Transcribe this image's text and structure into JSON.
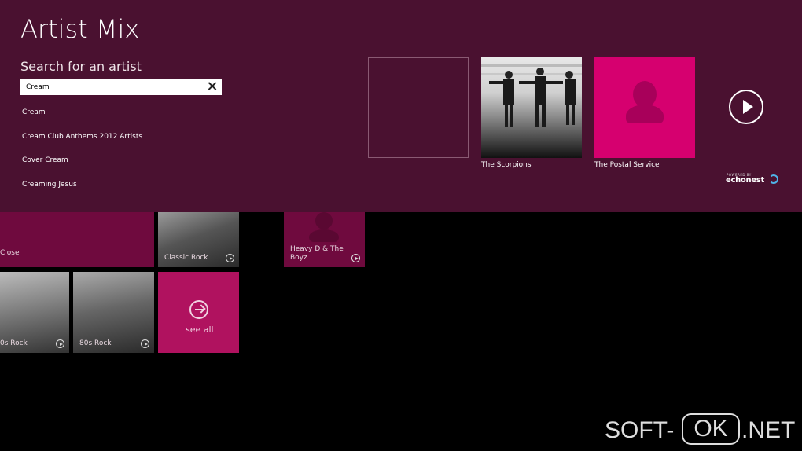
{
  "tiles": {
    "close_label": "Close",
    "classic_rock_label": "Classic Rock",
    "heavy_d_label": "Heavy D & The Boyz",
    "seventies_rock_label": "0s Rock",
    "eighties_rock_label": "80s Rock",
    "see_all_label": "see all"
  },
  "flyout": {
    "title": "Artist Mix",
    "search_label": "Search for an artist",
    "search_value": "Cream",
    "suggestions": [
      "Cream",
      "Cream Club Anthems 2012 Artists",
      "Cover Cream",
      "Creaming Jesus"
    ],
    "artists": [
      "The Scorpions",
      "The Postal Service"
    ],
    "powered_by": "POWERED BY",
    "brand": "echonest"
  },
  "watermark": {
    "left": "SOFT-",
    "middle": "OK",
    "right": ".NET"
  },
  "colors": {
    "panel": "#4a1130",
    "tile_magenta": "#6f0a3e",
    "artist_pink": "#d6006f"
  }
}
